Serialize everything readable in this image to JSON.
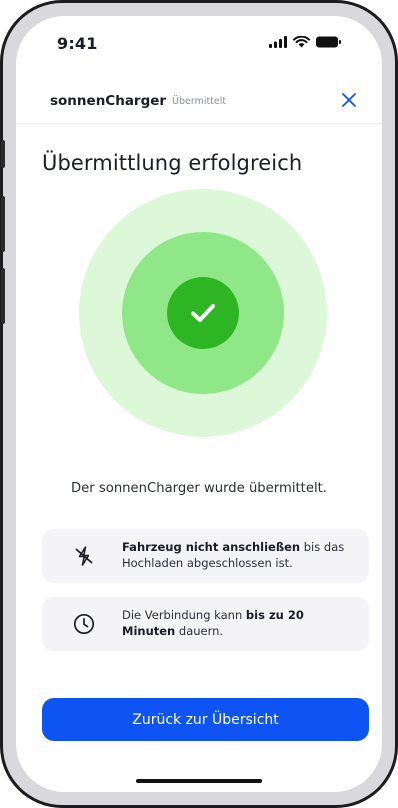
{
  "status_bar": {
    "time": "9:41"
  },
  "header": {
    "app_name": "sonnenCharger",
    "status": "Übermittelt"
  },
  "title": "Übermittlung erfolgreich",
  "message": "Der sonnenCharger wurde übermittelt.",
  "info_cards": [
    {
      "icon": "unplug-icon",
      "bold": "Fahrzeug nicht anschließen",
      "text": " bis das Hochladen abgeschlossen ist."
    },
    {
      "icon": "clock-icon",
      "text_before": "Die Verbindung kann ",
      "bold": "bis zu 20 Minuten",
      "text_after": " dauern."
    }
  ],
  "primary_button": {
    "label": "Zurück zur Übersicht"
  },
  "colors": {
    "accent": "#0d54f2",
    "success": "#2db523",
    "success_mid": "#8fe787",
    "success_light": "#dcf8d8"
  }
}
